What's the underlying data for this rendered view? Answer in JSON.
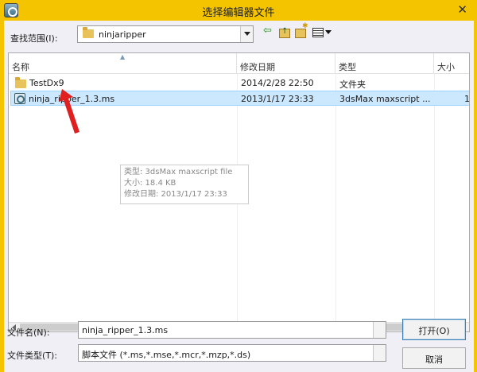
{
  "window": {
    "title": "选择编辑器文件",
    "close_glyph": "✕"
  },
  "lookin": {
    "label": "查找范围(I):",
    "value": "ninjaripper"
  },
  "toolbar": {
    "back_glyph": "⇦"
  },
  "columns": [
    {
      "label": "名称"
    },
    {
      "label": "修改日期"
    },
    {
      "label": "类型"
    },
    {
      "label": "大小"
    }
  ],
  "sort_glyph": "▲",
  "rows": [
    {
      "name": "TestDx9",
      "modified": "2014/2/28 22:50",
      "type": "文件夹",
      "size": "",
      "icon": "folder-icon",
      "selected": false
    },
    {
      "name": "ninja_ripper_1.3.ms",
      "modified": "2013/1/17 23:33",
      "type": "3dsMax maxscript ...",
      "size": "1",
      "icon": "maxscript-file-icon",
      "selected": true
    }
  ],
  "tooltip": {
    "line1": "类型: 3dsMax maxscript file",
    "line2": "大小: 18.4 KB",
    "line3": "修改日期: 2013/1/17 23:33"
  },
  "filename": {
    "label": "文件名(N):",
    "value": "ninja_ripper_1.3.ms"
  },
  "filetype": {
    "label": "文件类型(T):",
    "value": "脚本文件 (*.ms,*.mse,*.mcr,*.mzp,*.ds)"
  },
  "buttons": {
    "open": "打开(O)",
    "cancel": "取消"
  },
  "colors": {
    "titlebar": "#f5c400",
    "selection": "#cce8ff",
    "annotation_arrow": "#e02020"
  }
}
